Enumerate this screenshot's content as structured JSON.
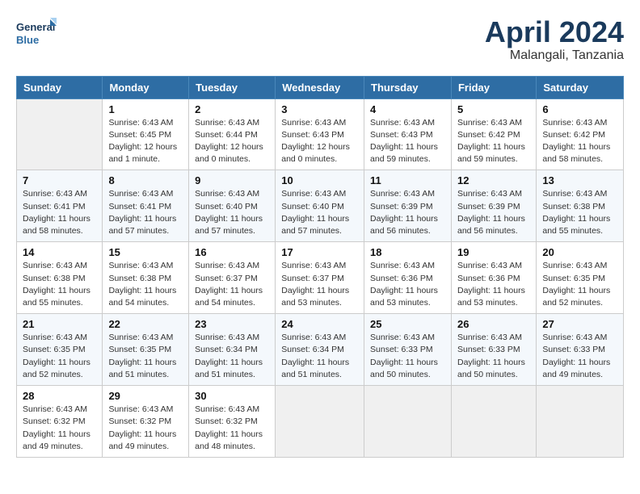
{
  "header": {
    "logo_line1": "General",
    "logo_line2": "Blue",
    "month_year": "April 2024",
    "location": "Malangali, Tanzania"
  },
  "weekdays": [
    "Sunday",
    "Monday",
    "Tuesday",
    "Wednesday",
    "Thursday",
    "Friday",
    "Saturday"
  ],
  "weeks": [
    [
      {
        "day": "",
        "empty": true
      },
      {
        "day": "1",
        "sunrise": "Sunrise: 6:43 AM",
        "sunset": "Sunset: 6:45 PM",
        "daylight": "Daylight: 12 hours and 1 minute."
      },
      {
        "day": "2",
        "sunrise": "Sunrise: 6:43 AM",
        "sunset": "Sunset: 6:44 PM",
        "daylight": "Daylight: 12 hours and 0 minutes."
      },
      {
        "day": "3",
        "sunrise": "Sunrise: 6:43 AM",
        "sunset": "Sunset: 6:43 PM",
        "daylight": "Daylight: 12 hours and 0 minutes."
      },
      {
        "day": "4",
        "sunrise": "Sunrise: 6:43 AM",
        "sunset": "Sunset: 6:43 PM",
        "daylight": "Daylight: 11 hours and 59 minutes."
      },
      {
        "day": "5",
        "sunrise": "Sunrise: 6:43 AM",
        "sunset": "Sunset: 6:42 PM",
        "daylight": "Daylight: 11 hours and 59 minutes."
      },
      {
        "day": "6",
        "sunrise": "Sunrise: 6:43 AM",
        "sunset": "Sunset: 6:42 PM",
        "daylight": "Daylight: 11 hours and 58 minutes."
      }
    ],
    [
      {
        "day": "7",
        "sunrise": "Sunrise: 6:43 AM",
        "sunset": "Sunset: 6:41 PM",
        "daylight": "Daylight: 11 hours and 58 minutes."
      },
      {
        "day": "8",
        "sunrise": "Sunrise: 6:43 AM",
        "sunset": "Sunset: 6:41 PM",
        "daylight": "Daylight: 11 hours and 57 minutes."
      },
      {
        "day": "9",
        "sunrise": "Sunrise: 6:43 AM",
        "sunset": "Sunset: 6:40 PM",
        "daylight": "Daylight: 11 hours and 57 minutes."
      },
      {
        "day": "10",
        "sunrise": "Sunrise: 6:43 AM",
        "sunset": "Sunset: 6:40 PM",
        "daylight": "Daylight: 11 hours and 57 minutes."
      },
      {
        "day": "11",
        "sunrise": "Sunrise: 6:43 AM",
        "sunset": "Sunset: 6:39 PM",
        "daylight": "Daylight: 11 hours and 56 minutes."
      },
      {
        "day": "12",
        "sunrise": "Sunrise: 6:43 AM",
        "sunset": "Sunset: 6:39 PM",
        "daylight": "Daylight: 11 hours and 56 minutes."
      },
      {
        "day": "13",
        "sunrise": "Sunrise: 6:43 AM",
        "sunset": "Sunset: 6:38 PM",
        "daylight": "Daylight: 11 hours and 55 minutes."
      }
    ],
    [
      {
        "day": "14",
        "sunrise": "Sunrise: 6:43 AM",
        "sunset": "Sunset: 6:38 PM",
        "daylight": "Daylight: 11 hours and 55 minutes."
      },
      {
        "day": "15",
        "sunrise": "Sunrise: 6:43 AM",
        "sunset": "Sunset: 6:38 PM",
        "daylight": "Daylight: 11 hours and 54 minutes."
      },
      {
        "day": "16",
        "sunrise": "Sunrise: 6:43 AM",
        "sunset": "Sunset: 6:37 PM",
        "daylight": "Daylight: 11 hours and 54 minutes."
      },
      {
        "day": "17",
        "sunrise": "Sunrise: 6:43 AM",
        "sunset": "Sunset: 6:37 PM",
        "daylight": "Daylight: 11 hours and 53 minutes."
      },
      {
        "day": "18",
        "sunrise": "Sunrise: 6:43 AM",
        "sunset": "Sunset: 6:36 PM",
        "daylight": "Daylight: 11 hours and 53 minutes."
      },
      {
        "day": "19",
        "sunrise": "Sunrise: 6:43 AM",
        "sunset": "Sunset: 6:36 PM",
        "daylight": "Daylight: 11 hours and 53 minutes."
      },
      {
        "day": "20",
        "sunrise": "Sunrise: 6:43 AM",
        "sunset": "Sunset: 6:35 PM",
        "daylight": "Daylight: 11 hours and 52 minutes."
      }
    ],
    [
      {
        "day": "21",
        "sunrise": "Sunrise: 6:43 AM",
        "sunset": "Sunset: 6:35 PM",
        "daylight": "Daylight: 11 hours and 52 minutes."
      },
      {
        "day": "22",
        "sunrise": "Sunrise: 6:43 AM",
        "sunset": "Sunset: 6:35 PM",
        "daylight": "Daylight: 11 hours and 51 minutes."
      },
      {
        "day": "23",
        "sunrise": "Sunrise: 6:43 AM",
        "sunset": "Sunset: 6:34 PM",
        "daylight": "Daylight: 11 hours and 51 minutes."
      },
      {
        "day": "24",
        "sunrise": "Sunrise: 6:43 AM",
        "sunset": "Sunset: 6:34 PM",
        "daylight": "Daylight: 11 hours and 51 minutes."
      },
      {
        "day": "25",
        "sunrise": "Sunrise: 6:43 AM",
        "sunset": "Sunset: 6:33 PM",
        "daylight": "Daylight: 11 hours and 50 minutes."
      },
      {
        "day": "26",
        "sunrise": "Sunrise: 6:43 AM",
        "sunset": "Sunset: 6:33 PM",
        "daylight": "Daylight: 11 hours and 50 minutes."
      },
      {
        "day": "27",
        "sunrise": "Sunrise: 6:43 AM",
        "sunset": "Sunset: 6:33 PM",
        "daylight": "Daylight: 11 hours and 49 minutes."
      }
    ],
    [
      {
        "day": "28",
        "sunrise": "Sunrise: 6:43 AM",
        "sunset": "Sunset: 6:32 PM",
        "daylight": "Daylight: 11 hours and 49 minutes."
      },
      {
        "day": "29",
        "sunrise": "Sunrise: 6:43 AM",
        "sunset": "Sunset: 6:32 PM",
        "daylight": "Daylight: 11 hours and 49 minutes."
      },
      {
        "day": "30",
        "sunrise": "Sunrise: 6:43 AM",
        "sunset": "Sunset: 6:32 PM",
        "daylight": "Daylight: 11 hours and 48 minutes."
      },
      {
        "day": "",
        "empty": true
      },
      {
        "day": "",
        "empty": true
      },
      {
        "day": "",
        "empty": true
      },
      {
        "day": "",
        "empty": true
      }
    ]
  ]
}
